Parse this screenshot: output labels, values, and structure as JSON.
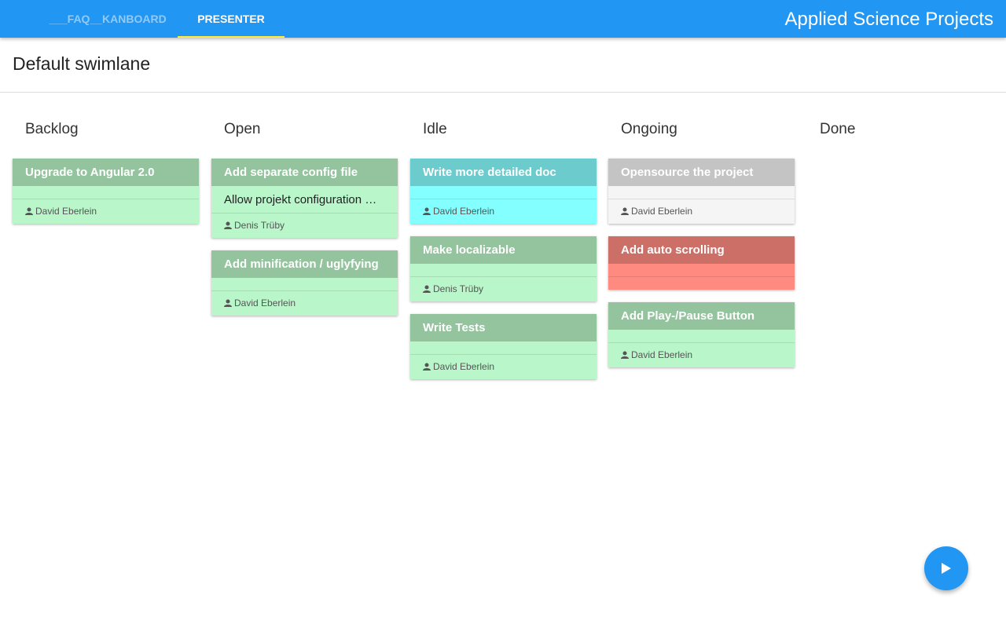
{
  "header": {
    "tabs": [
      {
        "label": "___FAQ__KANBOARD",
        "active": false
      },
      {
        "label": "PRESENTER",
        "active": true
      }
    ],
    "app_title": "Applied Science Projects",
    "colors": {
      "bar": "#2196f3",
      "active_indicator": "#ffeb3b",
      "inactive_tab": "#90caf9"
    }
  },
  "swimlane": {
    "title": "Default swimlane"
  },
  "columns": [
    {
      "name": "Backlog",
      "cards": [
        {
          "title": "Upgrade to Angular 2.0",
          "description": "",
          "assignee": "David Eberlein",
          "color": "green"
        }
      ]
    },
    {
      "name": "Open",
      "cards": [
        {
          "title": "Add separate config file",
          "description": "Allow projekt configuration …",
          "assignee": "Denis Trüby",
          "color": "green"
        },
        {
          "title": "Add minification / uglyfying",
          "description": "",
          "assignee": "David Eberlein",
          "color": "green"
        }
      ]
    },
    {
      "name": "Idle",
      "cards": [
        {
          "title": "Write more detailed doc",
          "description": "",
          "assignee": "David Eberlein",
          "color": "cyan"
        },
        {
          "title": "Make localizable",
          "description": "",
          "assignee": "Denis Trüby",
          "color": "green"
        },
        {
          "title": "Write Tests",
          "description": "",
          "assignee": "David Eberlein",
          "color": "green"
        }
      ]
    },
    {
      "name": "Ongoing",
      "cards": [
        {
          "title": "Opensource the project",
          "description": "",
          "assignee": "David Eberlein",
          "color": "grey"
        },
        {
          "title": "Add auto scrolling",
          "description": "",
          "assignee": "",
          "color": "red"
        },
        {
          "title": "Add Play-/Pause Button",
          "description": "",
          "assignee": "David Eberlein",
          "color": "green"
        }
      ]
    },
    {
      "name": "Done",
      "cards": []
    }
  ],
  "fab": {
    "icon": "play-icon",
    "color": "#2196f3"
  }
}
